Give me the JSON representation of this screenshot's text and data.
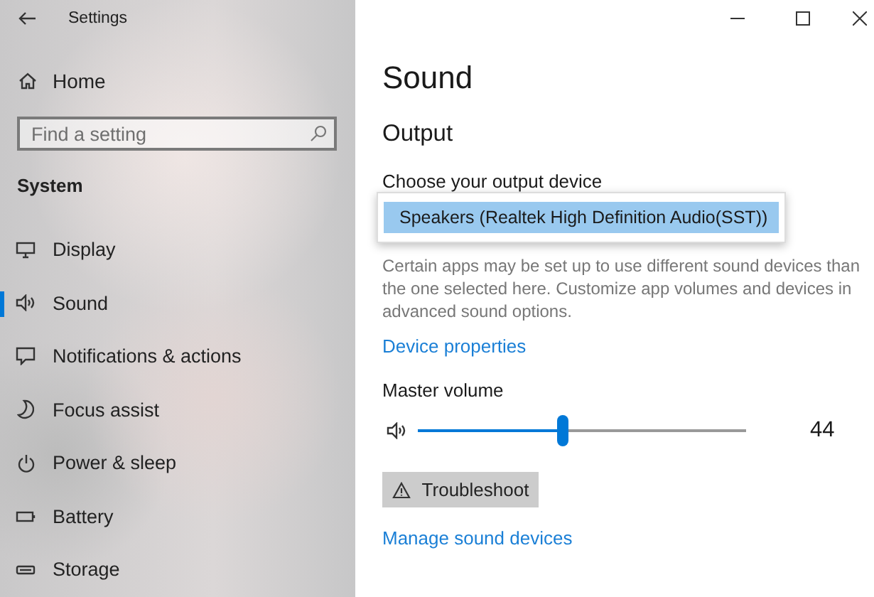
{
  "window": {
    "title": "Settings"
  },
  "sidebar": {
    "home": "Home",
    "search": {
      "placeholder": "Find a setting"
    },
    "section": "System",
    "items": [
      {
        "label": "Display",
        "selected": false
      },
      {
        "label": "Sound",
        "selected": true
      },
      {
        "label": "Notifications & actions",
        "selected": false
      },
      {
        "label": "Focus assist",
        "selected": false
      },
      {
        "label": "Power & sleep",
        "selected": false
      },
      {
        "label": "Battery",
        "selected": false
      },
      {
        "label": "Storage",
        "selected": false
      }
    ]
  },
  "content": {
    "title": "Sound",
    "section": "Output",
    "output_device": {
      "label": "Choose your output device",
      "options": [
        {
          "text": "Speakers (Realtek High Definition Audio(SST))",
          "selected": true
        }
      ]
    },
    "description": "Certain apps may be set up to use different sound devices than the one selected here. Customize app volumes and devices in advanced sound options.",
    "device_properties_link": "Device properties",
    "master_volume": {
      "label": "Master volume",
      "level": 0.44,
      "reading": "44"
    },
    "troubleshoot_button": "Troubleshoot",
    "manage_link": "Manage sound devices"
  }
}
